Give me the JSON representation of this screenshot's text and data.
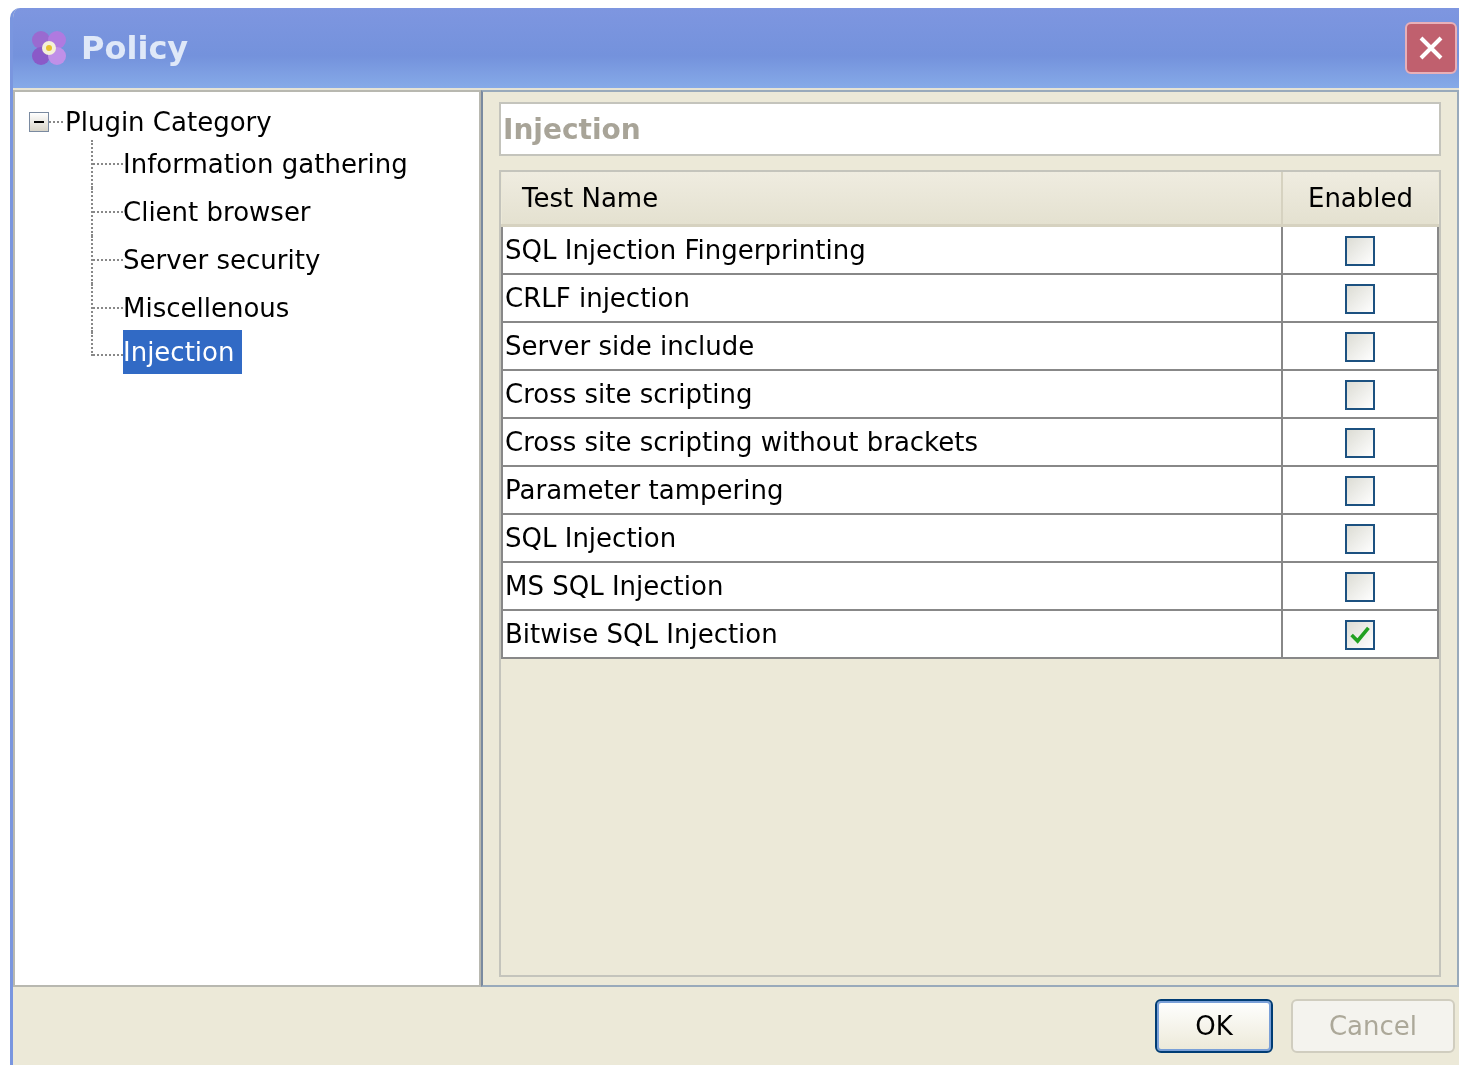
{
  "window": {
    "title": "Policy"
  },
  "tree": {
    "label": "Plugin Category",
    "expanded": true,
    "children": [
      {
        "label": "Information gathering",
        "selected": false
      },
      {
        "label": "Client browser",
        "selected": false
      },
      {
        "label": "Server security",
        "selected": false
      },
      {
        "label": "Miscellenous",
        "selected": false
      },
      {
        "label": "Injection",
        "selected": true
      }
    ]
  },
  "panel": {
    "title": "Injection"
  },
  "table": {
    "columns": [
      "Test Name",
      "Enabled"
    ],
    "rows": [
      {
        "name": "SQL Injection Fingerprinting",
        "checked": false
      },
      {
        "name": "CRLF injection",
        "checked": false
      },
      {
        "name": "Server side include",
        "checked": false
      },
      {
        "name": "Cross site scripting",
        "checked": false
      },
      {
        "name": "Cross site scripting without brackets",
        "checked": false
      },
      {
        "name": "Parameter tampering",
        "checked": false
      },
      {
        "name": "SQL Injection",
        "checked": false
      },
      {
        "name": "MS SQL Injection",
        "checked": false
      },
      {
        "name": "Bitwise SQL Injection",
        "checked": true
      }
    ]
  },
  "buttons": [
    {
      "label": "OK",
      "disabled": false
    },
    {
      "label": "Cancel",
      "disabled": true
    }
  ]
}
